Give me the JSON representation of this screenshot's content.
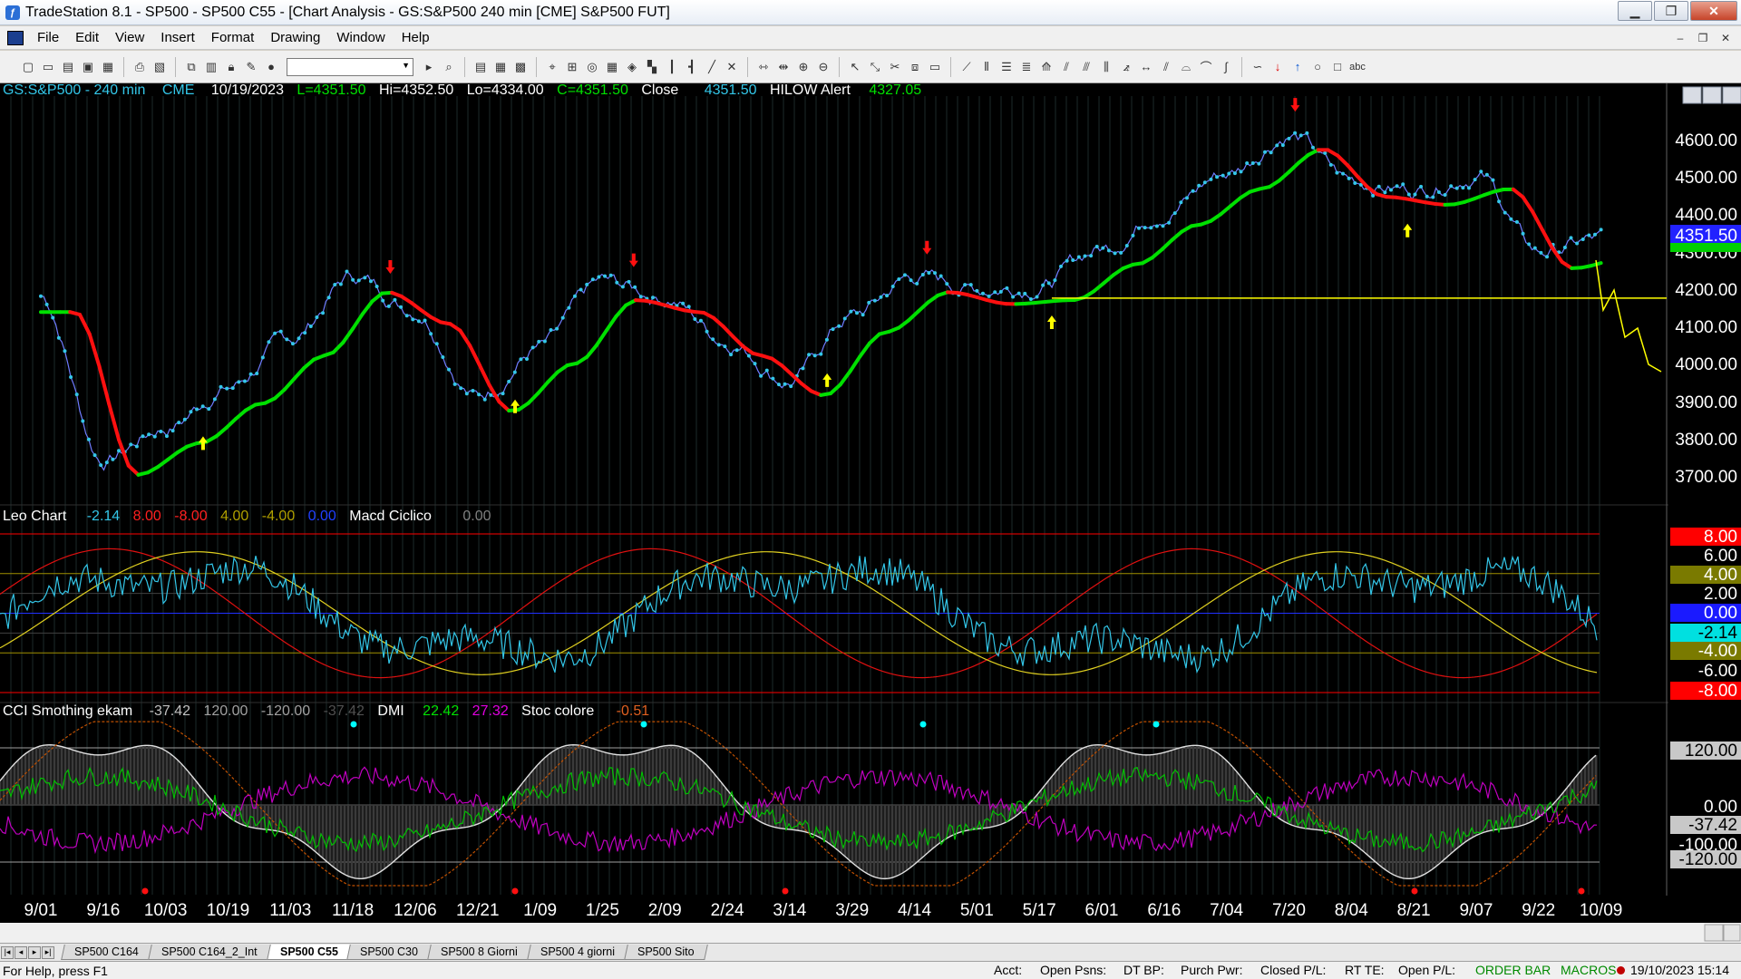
{
  "window": {
    "title": "TradeStation 8.1 - SP500 - SP500 C55 - [Chart Analysis - GS:S&P500  240 min  [CME] S&P500 FUT]",
    "minimize": "▁",
    "restore": "❐",
    "close": "✕"
  },
  "menu": {
    "items": [
      "File",
      "Edit",
      "View",
      "Insert",
      "Format",
      "Drawing",
      "Window",
      "Help"
    ],
    "mdi_minimize": "‒",
    "mdi_restore": "❐",
    "mdi_close": "✕"
  },
  "toolbar": {
    "symbol_combo_value": "",
    "icons": [
      "new-icon",
      "open-icon",
      "open-workspace-icon",
      "save-icon",
      "save-all-icon",
      "print-icon",
      "print-preview-icon",
      "cut-icon",
      "copy-icon",
      "paste-icon",
      "lock-icon",
      "pencil-icon",
      "palette-icon",
      "magnifier-icon",
      "data-window-icon",
      "bar-chart-icon",
      "candle-icon",
      "line-chart-icon",
      "zoom-in-icon",
      "zoom-out-icon",
      "pointer-icon",
      "insert-indicator-icon",
      "wrench-icon",
      "expert-icon",
      "trendline-icon",
      "fib-icon",
      "text-icon"
    ]
  },
  "chart": {
    "symbol_line": {
      "symbol": "GS:S&P500 - 240 min",
      "exchange": "CME",
      "date": "10/19/2023",
      "last": "L=4351.50",
      "high": "Hi=4352.50",
      "low": "Lo=4334.00",
      "close_c": "C=4351.50",
      "close_label": "Close",
      "close_value": "4351.50",
      "alert_label": "HILOW Alert",
      "alert_value": "4327.05"
    },
    "price_axis_labels": [
      "4600.00",
      "4500.00",
      "4400.00",
      "4300.00",
      "4200.00",
      "4100.00",
      "4000.00",
      "3900.00",
      "3800.00",
      "3700.00"
    ],
    "last_price_tag": "4351.50",
    "leo_line": {
      "name": "Leo Chart",
      "v1": "-2.14",
      "v2": "8.00",
      "v3": "-8.00",
      "v4": "4.00",
      "v5": "-4.00",
      "v6": "0.00",
      "name2": "Macd Ciclico",
      "v7": "0.00"
    },
    "leo_axis_labels": [
      "8.00",
      "6.00",
      "4.00",
      "2.00",
      "0.00",
      "-2.14",
      "-4.00",
      "-6.00",
      "-8.00"
    ],
    "cci_line": {
      "name": "CCI Smothing ekam",
      "v1": "-37.42",
      "v2": "120.00",
      "v3": "-120.00",
      "v4": "-37.42",
      "name2": "DMI",
      "v5": "22.42",
      "v6": "27.32",
      "name3": "Stoc colore",
      "v7": "-0.51"
    },
    "cci_axis_labels": [
      "120.00",
      "0.00",
      "-37.42",
      "-100.00",
      "-120.00"
    ],
    "time_axis_labels": [
      "9/01",
      "9/16",
      "10/03",
      "10/19",
      "11/03",
      "11/18",
      "12/06",
      "12/21",
      "1/09",
      "1/25",
      "2/09",
      "2/24",
      "3/14",
      "3/29",
      "4/14",
      "5/01",
      "5/17",
      "6/01",
      "6/16",
      "7/04",
      "7/20",
      "8/04",
      "8/21",
      "9/07",
      "9/22",
      "10/09"
    ],
    "colors": {
      "background": "#000000",
      "price": "#33c6e8",
      "uptrend": "#00e000",
      "downtrend": "#ff1010",
      "alert": "#ffff00",
      "dmi_plus": "#00c000",
      "dmi_minus": "#c000c0",
      "cci": "#e0e0e0",
      "stoc": "#c05000"
    }
  },
  "chart_data": {
    "type": "line",
    "title": "GS:S&P500 - 240 min",
    "x": [
      "9/01",
      "9/16",
      "10/03",
      "10/19",
      "11/03",
      "11/18",
      "12/06",
      "12/21",
      "1/09",
      "1/25",
      "2/09",
      "2/24",
      "3/14",
      "3/29",
      "4/14",
      "5/01",
      "5/17",
      "6/01",
      "6/16",
      "7/04",
      "7/20",
      "8/04",
      "8/21",
      "9/07",
      "9/22",
      "10/09"
    ],
    "ylim": [
      3650,
      4700
    ],
    "series": [
      {
        "name": "Close",
        "values": [
          4210,
          3800,
          3880,
          3980,
          4100,
          4260,
          4180,
          3960,
          4080,
          4240,
          4210,
          4100,
          4000,
          4160,
          4260,
          4230,
          4240,
          4330,
          4430,
          4520,
          4620,
          4500,
          4480,
          4520,
          4320,
          4351.5
        ]
      },
      {
        "name": "HILOW Alert",
        "values": [
          4327.05
        ]
      }
    ]
  },
  "sheets": {
    "tabs": [
      "SP500 C164",
      "SP500 C164_2_Int",
      "SP500 C55",
      "SP500 C30",
      "SP500 8 Giorni",
      "SP500 4 giorni",
      "SP500 Sito"
    ],
    "active_index": 2
  },
  "status": {
    "help": "For Help, press F1",
    "acct": "Acct:",
    "open_psns": "Open Psns:",
    "dt_bp": "DT BP:",
    "purch_pwr": "Purch Pwr:",
    "closed_pl": "Closed P/L:",
    "rt_te": "RT TE:",
    "open_pl": "Open P/L:",
    "order_bar": "ORDER BAR",
    "macros": "MACROS",
    "datetime": "19/10/2023 15:14"
  }
}
